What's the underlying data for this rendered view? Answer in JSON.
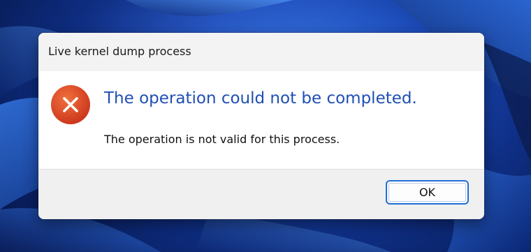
{
  "window": {
    "title": "Live kernel dump process"
  },
  "message": {
    "main_instruction": "The operation could not be completed.",
    "content": "The operation is not valid for this process.",
    "icon": "error-icon"
  },
  "buttons": {
    "ok_label": "OK"
  },
  "colors": {
    "main_instruction": "#1f4fb4",
    "error_icon": "#d9441c",
    "button_border": "#1f6fd6",
    "wallpaper": "#1d4fc0"
  }
}
